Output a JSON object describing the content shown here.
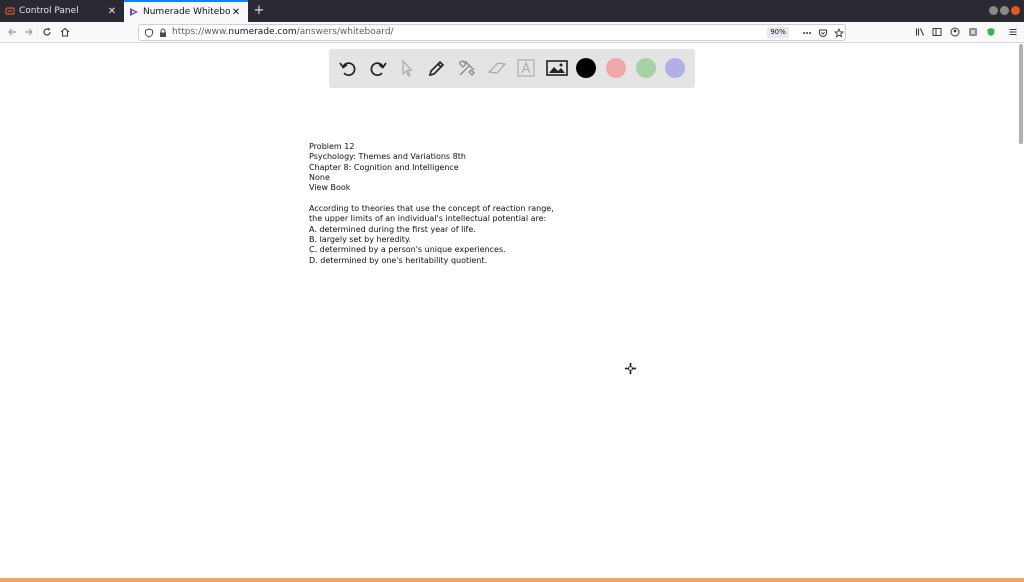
{
  "browser": {
    "tabs": [
      {
        "title": "Control Panel",
        "icon": "control-panel-icon",
        "active": false
      },
      {
        "title": "Numerade Whiteboard",
        "icon": "numerade-logo-icon",
        "active": true
      }
    ],
    "url": {
      "prefix": "https://www.",
      "host": "numerade.com",
      "path": "/answers/whiteboard/"
    },
    "zoom": "90%",
    "colors": {
      "tabstrip": "#2b2a33",
      "active_tab": "#f9f9fb",
      "accent": "#0a84ff",
      "page_bottom_bar": "#f4a261"
    }
  },
  "toolbar": {
    "tools": [
      "undo-icon",
      "redo-icon",
      "select-pointer-icon",
      "pen-icon",
      "tools-icon",
      "eraser-icon",
      "text-icon",
      "image-icon"
    ],
    "colors": [
      "#000000",
      "#f0a8a8",
      "#a8d0a8",
      "#b0b0e8"
    ]
  },
  "problem": {
    "lines": [
      "Problem 12",
      "Psychology: Themes and Variations 8th",
      "Chapter 8: Cognition and Intelligence",
      "None",
      "View Book"
    ],
    "question_lines": [
      "According to theories that use the concept of reaction range,",
      "the upper limits of an individual's intellectual potential are:",
      "A. determined during the first year of life.",
      "B. largely set by heredity.",
      "C. determined by a person's unique experiences.",
      "D. determined by one's heritability quotient."
    ]
  }
}
